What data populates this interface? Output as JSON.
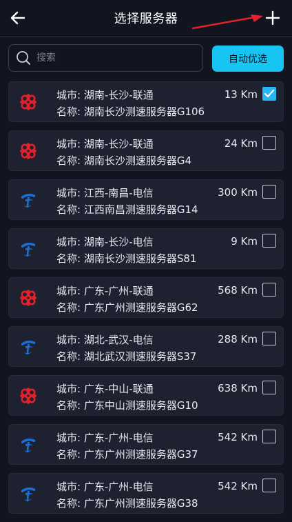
{
  "header": {
    "title": "选择服务器",
    "back_icon": "arrow-left-icon",
    "add_icon": "plus-icon"
  },
  "search": {
    "placeholder": "搜索",
    "value": ""
  },
  "auto_select_label": "自动优选",
  "colors": {
    "background": "#121520",
    "card": "#1e2230",
    "accent": "#17c4f2",
    "checkbox_checked": "#29b6f6",
    "unicom_red": "#e5202a",
    "telecom_blue": "#1a6fd6",
    "annotation_arrow": "#e0222a"
  },
  "servers": [
    {
      "city": "城市: 湖南-长沙-联通",
      "name": "名称: 湖南长沙测速服务器G106",
      "distance": "13 Km",
      "isp": "unicom",
      "checked": true
    },
    {
      "city": "城市: 湖南-长沙-联通",
      "name": "名称: 湖南长沙测速服务器G4",
      "distance": "24 Km",
      "isp": "unicom",
      "checked": false
    },
    {
      "city": "城市: 江西-南昌-电信",
      "name": "名称: 江西南昌测速服务器G14",
      "distance": "300 Km",
      "isp": "telecom",
      "checked": false
    },
    {
      "city": "城市: 湖南-长沙-电信",
      "name": "名称: 湖南长沙测速服务器S81",
      "distance": "9 Km",
      "isp": "telecom",
      "checked": false
    },
    {
      "city": "城市: 广东-广州-联通",
      "name": "名称: 广东广州测速服务器G62",
      "distance": "568 Km",
      "isp": "unicom",
      "checked": false
    },
    {
      "city": "城市: 湖北-武汉-电信",
      "name": "名称: 湖北武汉测速服务器S37",
      "distance": "288 Km",
      "isp": "telecom",
      "checked": false
    },
    {
      "city": "城市: 广东-中山-联通",
      "name": "名称: 广东中山测速服务器G10",
      "distance": "638 Km",
      "isp": "unicom",
      "checked": false
    },
    {
      "city": "城市: 广东-广州-电信",
      "name": "名称: 广东广州测速服务器G37",
      "distance": "542 Km",
      "isp": "telecom",
      "checked": false
    },
    {
      "city": "城市: 广东-广州-电信",
      "name": "名称: 广东广州测速服务器G38",
      "distance": "542 Km",
      "isp": "telecom",
      "checked": false
    }
  ]
}
